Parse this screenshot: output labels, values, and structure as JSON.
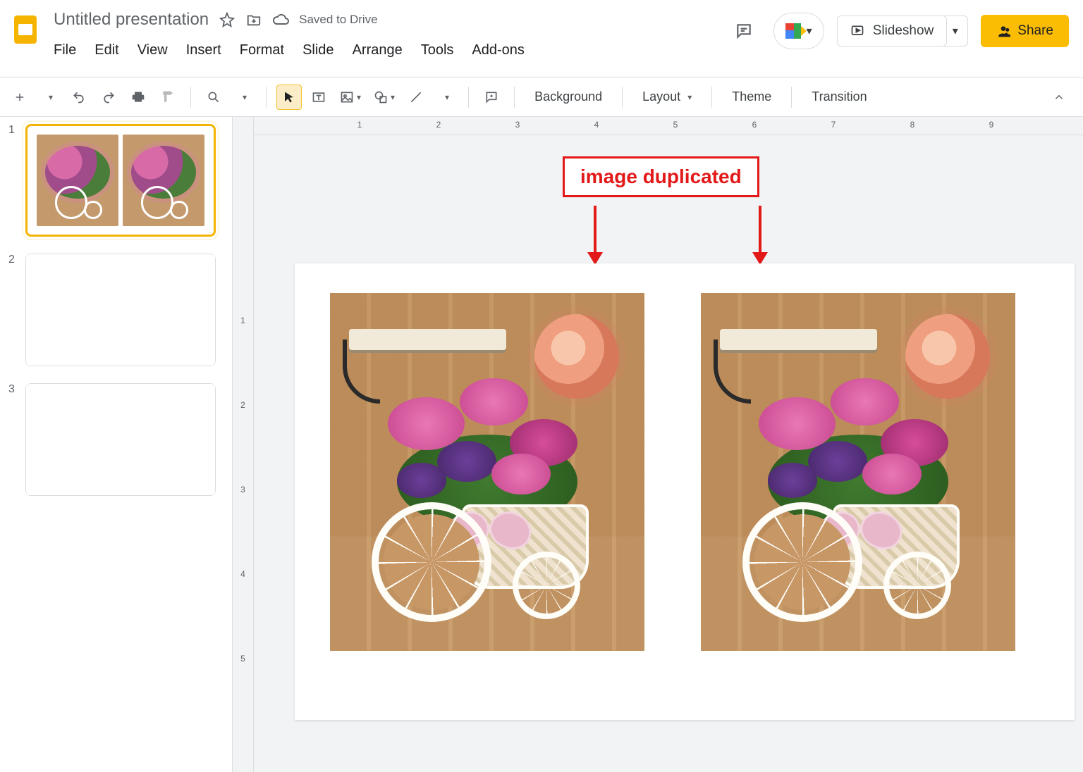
{
  "app": {
    "title": "Untitled presentation",
    "saved_text": "Saved to Drive"
  },
  "menus": [
    "File",
    "Edit",
    "View",
    "Insert",
    "Format",
    "Slide",
    "Arrange",
    "Tools",
    "Add-ons"
  ],
  "header_actions": {
    "slideshow": "Slideshow",
    "share": "Share"
  },
  "toolbar_text": {
    "background": "Background",
    "layout": "Layout",
    "theme": "Theme",
    "transition": "Transition"
  },
  "ruler": {
    "horizontal": [
      "1",
      "2",
      "3",
      "4",
      "5",
      "6",
      "7",
      "8",
      "9"
    ],
    "vertical": [
      "1",
      "2",
      "3",
      "4",
      "5"
    ]
  },
  "thumbnails": [
    {
      "number": "1",
      "selected": true,
      "content": "two-images"
    },
    {
      "number": "2",
      "selected": false,
      "content": "blank"
    },
    {
      "number": "3",
      "selected": false,
      "content": "blank"
    }
  ],
  "annotation": {
    "label": "image duplicated"
  },
  "colors": {
    "brand_yellow": "#fbbc04",
    "annotation_red": "#e31818"
  }
}
